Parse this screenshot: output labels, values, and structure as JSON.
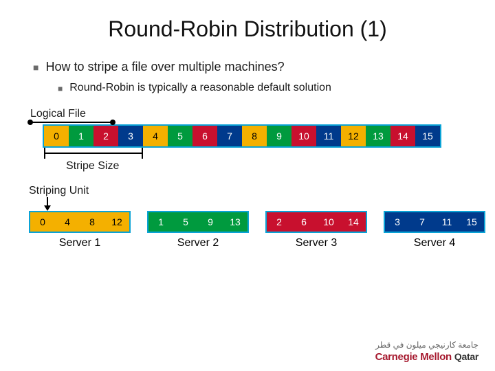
{
  "title": "Round-Robin Distribution (1)",
  "bullets": {
    "b1": "How to stripe a file over multiple machines?",
    "b2": "Round-Robin is typically a reasonable default solution"
  },
  "labels": {
    "logical_file": "Logical File",
    "stripe_size": "Stripe Size",
    "striping_unit": "Striping Unit"
  },
  "logical": {
    "cells": [
      "0",
      "1",
      "2",
      "3",
      "4",
      "5",
      "6",
      "7",
      "8",
      "9",
      "10",
      "11",
      "12",
      "13",
      "14",
      "15"
    ]
  },
  "color_cycle": [
    "c-y",
    "c-g",
    "c-r",
    "c-b"
  ],
  "servers": [
    {
      "label": "Server 1",
      "color": "c-y",
      "cells": [
        "0",
        "4",
        "8",
        "12"
      ]
    },
    {
      "label": "Server 2",
      "color": "c-g",
      "cells": [
        "1",
        "5",
        "9",
        "13"
      ]
    },
    {
      "label": "Server 3",
      "color": "c-r",
      "cells": [
        "2",
        "6",
        "10",
        "14"
      ]
    },
    {
      "label": "Server 4",
      "color": "c-b",
      "cells": [
        "3",
        "7",
        "11",
        "15"
      ]
    }
  ],
  "footer": {
    "arabic": "جامعة كارنيجي ميلون في قطر",
    "brand": "Carnegie Mellon",
    "loc": "Qatar"
  }
}
